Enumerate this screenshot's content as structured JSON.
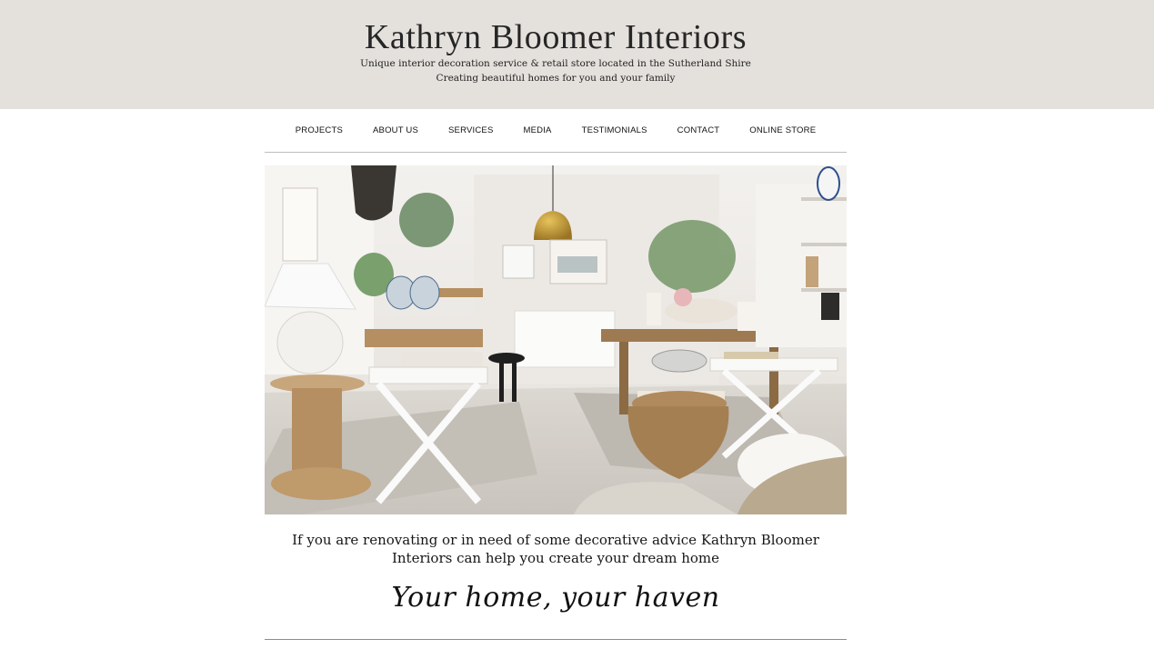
{
  "header": {
    "title": "Kathryn Bloomer Interiors",
    "tagline_1": "Unique interior decoration service & retail store located in the Sutherland Shire",
    "tagline_2": "Creating beautiful homes for you and your family",
    "background_color": "#e4e1dd"
  },
  "nav": {
    "items": [
      {
        "label": "PROJECTS"
      },
      {
        "label": "ABOUT US"
      },
      {
        "label": "SERVICES"
      },
      {
        "label": "MEDIA"
      },
      {
        "label": "TESTIMONIALS"
      },
      {
        "label": "CONTACT"
      },
      {
        "label": "ONLINE STORE"
      }
    ]
  },
  "hero": {
    "image_icon": "store-interior-photo"
  },
  "main": {
    "intro_line_1": "If you are renovating or in need of some decorative advice Kathryn Bloomer",
    "intro_line_2": "Interiors can help you create your dream home",
    "script_tagline": "Your home, your haven"
  }
}
